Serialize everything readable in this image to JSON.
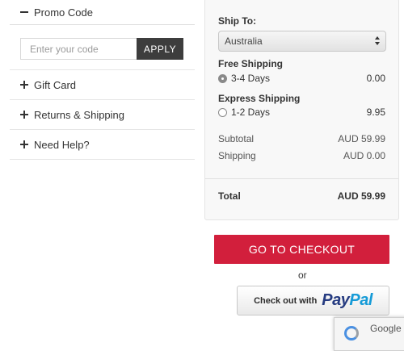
{
  "promo": {
    "title": "Promo Code",
    "input_placeholder": "Enter your code",
    "input_value": "",
    "apply_label": "APPLY"
  },
  "accordion": [
    {
      "label": "Gift Card",
      "icon": "plus-icon"
    },
    {
      "label": "Returns & Shipping",
      "icon": "plus-icon"
    },
    {
      "label": "Need Help?",
      "icon": "plus-icon"
    }
  ],
  "shipping": {
    "ship_to_label": "Ship To:",
    "country": "Australia",
    "options": [
      {
        "title": "Free Shipping",
        "label": "3-4 Days",
        "price": "0.00",
        "selected": true
      },
      {
        "title": "Express Shipping",
        "label": "1-2 Days",
        "price": "9.95",
        "selected": false
      }
    ]
  },
  "summary": {
    "subtotal_label": "Subtotal",
    "subtotal_value": "AUD 59.99",
    "shipping_label": "Shipping",
    "shipping_value": "AUD 0.00",
    "total_label": "Total",
    "total_value": "AUD 59.99"
  },
  "actions": {
    "checkout_label": "GO TO CHECKOUT",
    "or_text": "or",
    "paypal_prefix": "Check out with",
    "paypal_pay": "Pay",
    "paypal_pal": "Pal"
  },
  "recaptcha": {
    "text": "Google"
  },
  "colors": {
    "checkout": "#d21f3c",
    "apply": "#3d3d3d",
    "paypal_dark": "#253b80",
    "paypal_light": "#169bd7"
  }
}
